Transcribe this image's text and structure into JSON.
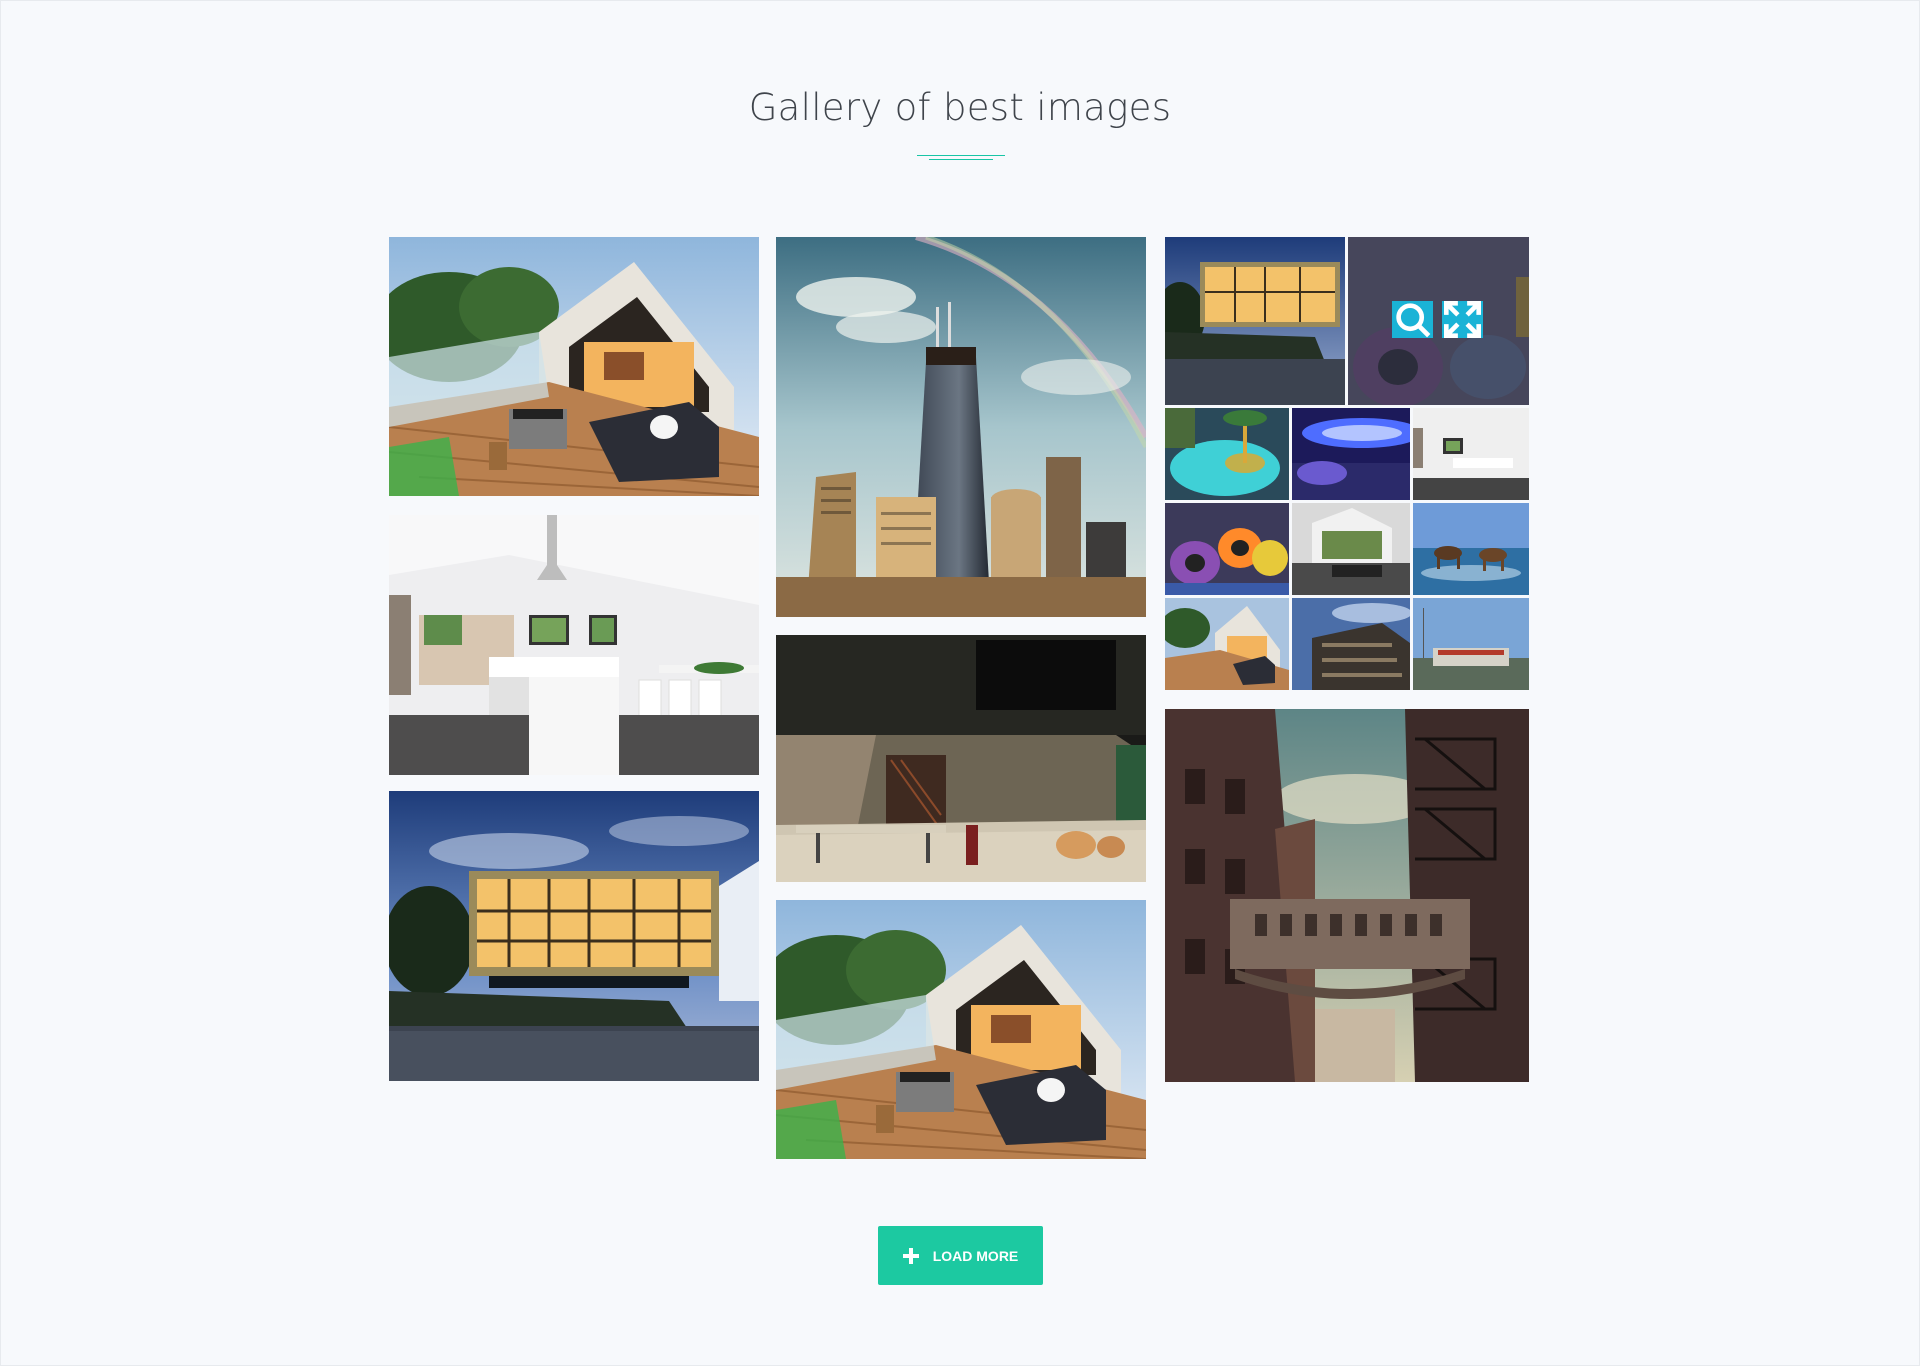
{
  "section": {
    "title": "Gallery of best images"
  },
  "actions": {
    "load_more_label": "LOAD MORE"
  },
  "overlay": {
    "zoom_icon": "search-icon",
    "fullscreen_icon": "expand-icon"
  },
  "colors": {
    "accent": "#1cc9a1",
    "overlay_button": "#1ab3d6",
    "background": "#f7f9fc",
    "heading": "#3f444b"
  }
}
